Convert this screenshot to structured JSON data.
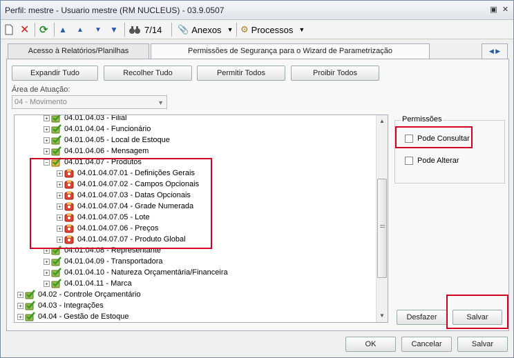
{
  "window": {
    "title": "Perfil: mestre - Usuario mestre (RM NUCLEUS) - 03.9.0507"
  },
  "toolbar": {
    "counter": "7/14",
    "anexos": "Anexos",
    "processos": "Processos"
  },
  "tabs": [
    {
      "label": "Acesso à Relatórios/Planilhas"
    },
    {
      "label": "Permissões de Segurança para o Wizard de Parametrização"
    }
  ],
  "actions": {
    "expand": "Expandir Tudo",
    "collapse": "Recolher Tudo",
    "allow_all": "Permitir Todos",
    "deny_all": "Proibir Todos"
  },
  "area": {
    "label": "Área de Atuação:",
    "value": "04 - Movimento"
  },
  "tree": {
    "rows": [
      {
        "label": "04.01.04.03 - Filial",
        "level": 2,
        "type": "ok"
      },
      {
        "label": "04.01.04.04 - Funcionário",
        "level": 2,
        "type": "ok"
      },
      {
        "label": "04.01.04.05 - Local de Estoque",
        "level": 2,
        "type": "ok"
      },
      {
        "label": "04.01.04.06 - Mensagem",
        "level": 2,
        "type": "ok"
      },
      {
        "label": "04.01.04.07 - Produtos",
        "level": 2,
        "type": "partial",
        "expanded": true
      },
      {
        "label": "04.01.04.07.01 - Definições Gerais",
        "level": 3,
        "type": "denied"
      },
      {
        "label": "04.01.04.07.02 - Campos Opcionais",
        "level": 3,
        "type": "denied"
      },
      {
        "label": "04.01.04.07.03 - Datas Opcionais",
        "level": 3,
        "type": "denied"
      },
      {
        "label": "04.01.04.07.04 - Grade Numerada",
        "level": 3,
        "type": "denied"
      },
      {
        "label": "04.01.04.07.05 - Lote",
        "level": 3,
        "type": "denied"
      },
      {
        "label": "04.01.04.07.06 - Preços",
        "level": 3,
        "type": "denied"
      },
      {
        "label": "04.01.04.07.07 - Produto Global",
        "level": 3,
        "type": "denied"
      },
      {
        "label": "04.01.04.08 - Representante",
        "level": 2,
        "type": "ok"
      },
      {
        "label": "04.01.04.09 - Transportadora",
        "level": 2,
        "type": "ok"
      },
      {
        "label": "04.01.04.10 - Natureza Orçamentária/Financeira",
        "level": 2,
        "type": "ok"
      },
      {
        "label": "04.01.04.11 - Marca",
        "level": 2,
        "type": "ok"
      },
      {
        "label": "04.02 - Controle Orçamentário",
        "level": 0,
        "type": "ok"
      },
      {
        "label": "04.03 - Integrações",
        "level": 0,
        "type": "ok"
      },
      {
        "label": "04.04 - Gestão de Estoque",
        "level": 0,
        "type": "ok"
      }
    ]
  },
  "permissions": {
    "title": "Permissões",
    "can_view": "Pode Consultar",
    "can_edit": "Pode Alterar"
  },
  "panel_buttons": {
    "undo": "Desfazer",
    "save": "Salvar"
  },
  "footer": {
    "ok": "OK",
    "cancel": "Cancelar",
    "save": "Salvar"
  },
  "colors": {
    "highlight": "#d00020",
    "ok_icon": "#3a9a2a",
    "denied_icon": "#e04030"
  }
}
